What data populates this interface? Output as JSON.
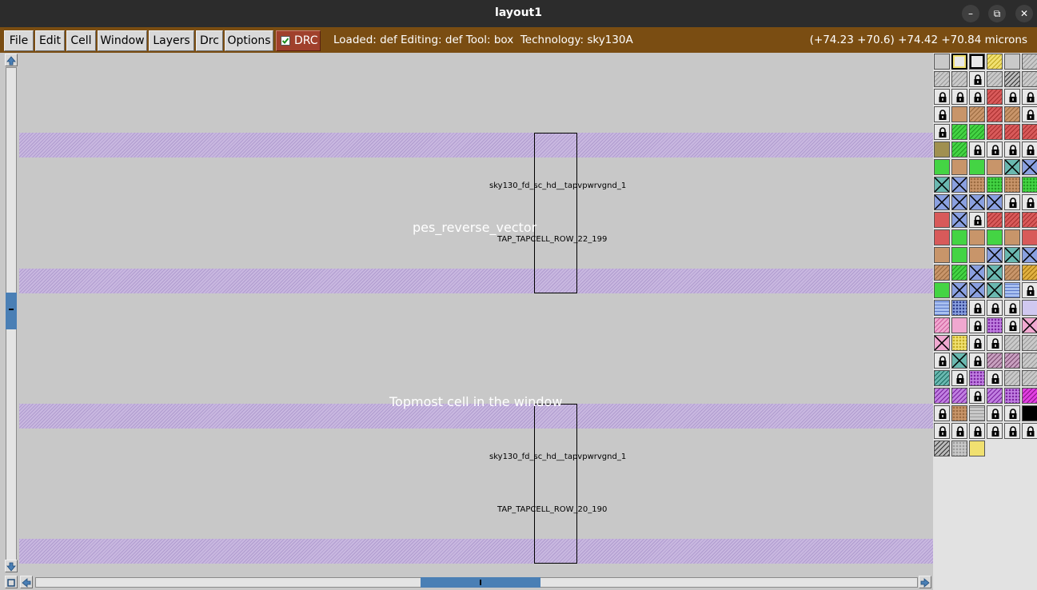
{
  "window": {
    "title": "layout1",
    "controls": {
      "minimize": "–",
      "maximize": "⧉",
      "close": "✕"
    }
  },
  "menubar": {
    "menus": [
      "File",
      "Edit",
      "Cell",
      "Window",
      "Layers",
      "Drc",
      "Options"
    ],
    "drc_toggle": {
      "label": "DRC",
      "checked": true
    },
    "status": "Loaded: def Editing: def Tool: box  Technology: sky130A",
    "coordinates": "(+74.23 +70.6) +74.42 +70.84 microns",
    "colors": {
      "bar": "#7a4d12",
      "drc": "#a0402c"
    }
  },
  "layout": {
    "cells": [
      {
        "cell_name": "sky130_fd_sc_hd__tapvpwrvgnd_1",
        "instance_name": "TAP_TAPCELL_ROW_22_199"
      },
      {
        "cell_name": "sky130_fd_sc_hd__tapvpwrvgnd_1",
        "instance_name": "TAP_TAPCELL_ROW_20_190"
      }
    ],
    "labels": {
      "top_cell": "pes_reverse_vector",
      "window_note": "Topmost cell in the window"
    },
    "rail_color": "#c9b8e0"
  },
  "layer_palette": {
    "rows": [
      [
        "grid-white",
        "yellow-outline",
        "black-outline",
        "yellow-hatch",
        "gray-solid",
        "gray-hatch"
      ],
      [
        "gray-hatch",
        "gray-hatch",
        "lock",
        "gray-hatch",
        "dark-hatch",
        "gray-hatch"
      ],
      [
        "lock",
        "lock",
        "lock",
        "red-hatch",
        "lock",
        "lock"
      ],
      [
        "lock",
        "tan-solid",
        "tan-hatch",
        "red-hatch",
        "tan-hatch",
        "lock"
      ],
      [
        "lock",
        "green-hatch",
        "green-hatch",
        "red-hatch",
        "red-hatch",
        "red-hatch"
      ],
      [
        "olive-solid",
        "green-hatch",
        "lock",
        "lock",
        "lock",
        "lock"
      ],
      [
        "green-solid",
        "tan-solid",
        "green-solid",
        "tan-solid",
        "teal-cross",
        "blue-cross"
      ],
      [
        "teal-cross",
        "blue-cross",
        "tan-dots",
        "green-dots",
        "tan-dots",
        "green-dots"
      ],
      [
        "blue-cross",
        "blue-cross",
        "blue-cross",
        "blue-cross",
        "lock",
        "lock"
      ],
      [
        "red-solid",
        "blue-cross",
        "lock",
        "red-hatch",
        "red-hatch",
        "red-hatch"
      ],
      [
        "red-solid",
        "green-solid",
        "tan-solid",
        "green-solid",
        "tan-solid",
        "red-solid"
      ],
      [
        "tan-solid",
        "green-solid",
        "tan-solid",
        "blue-cross",
        "teal-cross",
        "blue-cross"
      ],
      [
        "tan-hatch",
        "green-hatch",
        "blue-cross",
        "teal-cross",
        "tan-hatch",
        "gold-hatch"
      ],
      [
        "green-solid",
        "blue-cross",
        "blue-cross",
        "teal-cross",
        "lightblue-wave",
        "lock"
      ],
      [
        "lightblue-wave",
        "blue-dots",
        "lock",
        "lock",
        "lock",
        "lavender-solid"
      ],
      [
        "pink-hatch",
        "pink-solid",
        "lock",
        "purple-dots",
        "lock",
        "pink-cross"
      ],
      [
        "pink-cross",
        "yellow-dots",
        "lock",
        "lock",
        "gray-hatch",
        "gray-hatch"
      ],
      [
        "lock",
        "teal-cross",
        "lock",
        "mauve-hatch",
        "mauve-hatch",
        "gray-hatch"
      ],
      [
        "teal-hatch",
        "lock",
        "purple-dots",
        "lock",
        "gray-hatch",
        "gray-hatch"
      ],
      [
        "purple-hatch",
        "purple-hatch",
        "lock",
        "purple-hatch",
        "purple-dots",
        "magenta-hatch"
      ],
      [
        "lock",
        "tan-dots",
        "gray-wave",
        "lock",
        "lock",
        "black-solid"
      ],
      [
        "lock",
        "lock",
        "lock",
        "lock",
        "lock",
        "lock"
      ],
      [
        "dark-hatch",
        "gray-dots",
        "yellow-solid"
      ]
    ]
  }
}
